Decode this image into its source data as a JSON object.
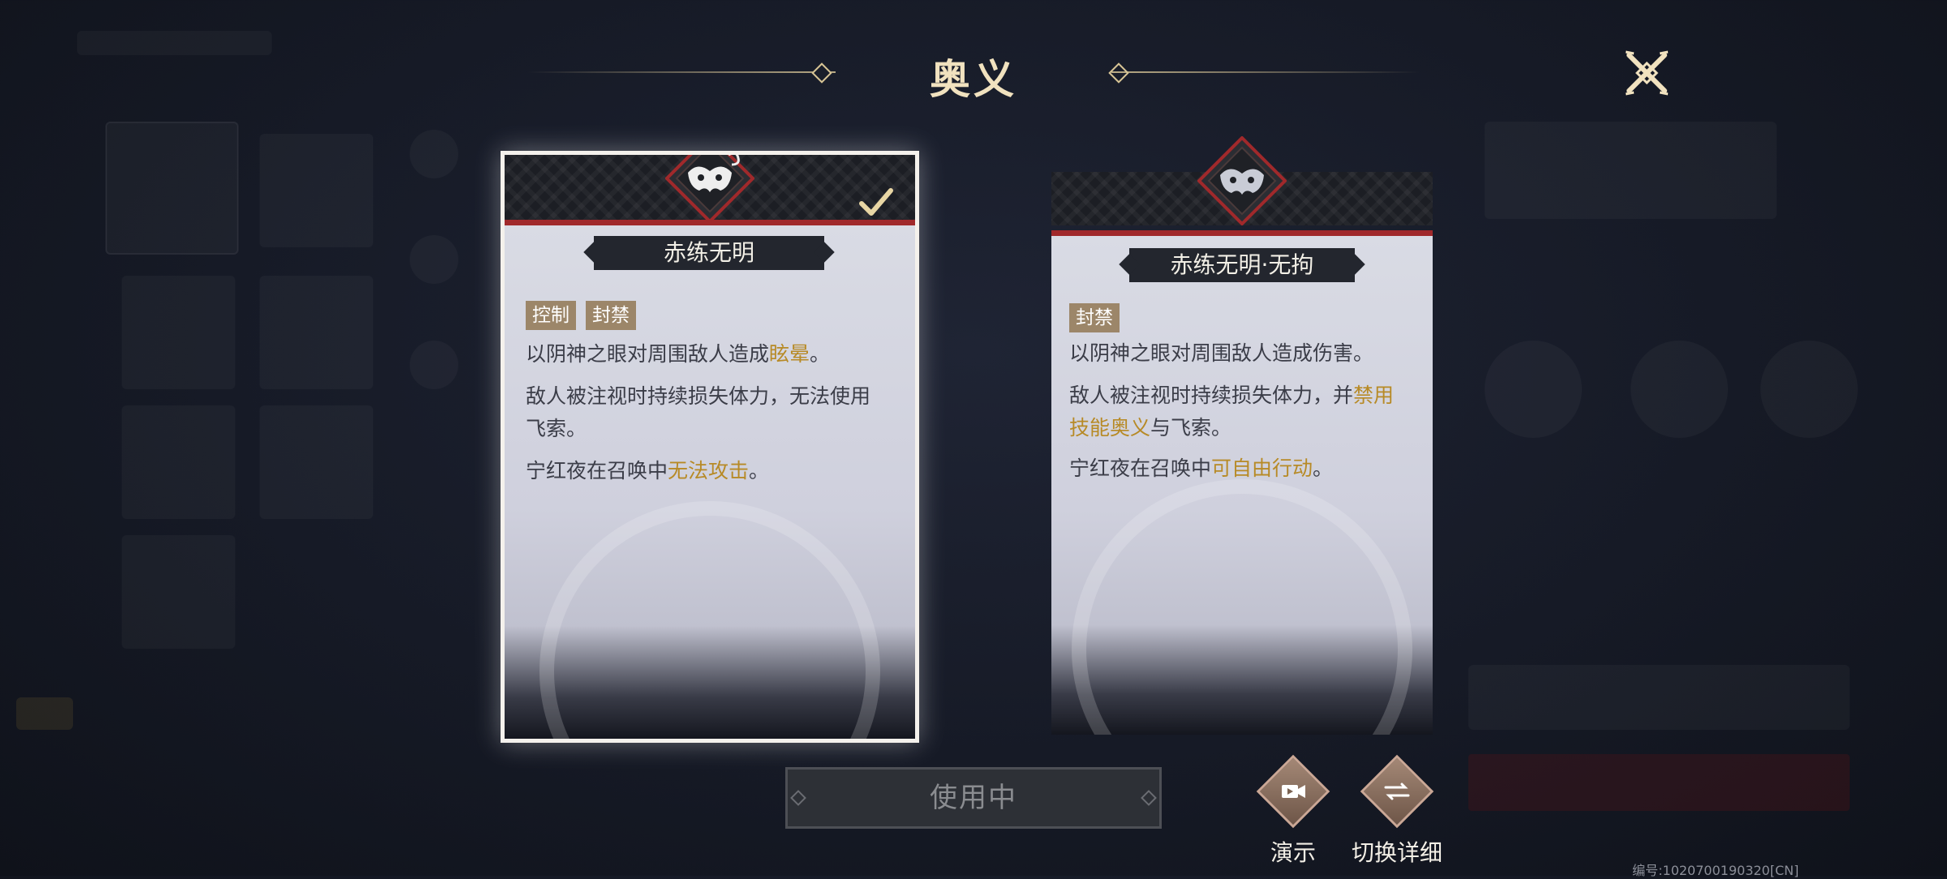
{
  "header": {
    "title": "奥义"
  },
  "cards": [
    {
      "name": "赤练无明",
      "selected": true,
      "tags": [
        "控制",
        "封禁"
      ],
      "lines": [
        {
          "pre": "以阴神之眼对周围敌人造成",
          "hl": "眩晕",
          "post": "。"
        },
        {
          "pre": "敌人被注视时持续损失体力，无法使用飞索。",
          "hl": "",
          "post": ""
        },
        {
          "pre": "宁红夜在召唤中",
          "hl": "无法攻击",
          "post": "。"
        }
      ]
    },
    {
      "name": "赤练无明·无拘",
      "selected": false,
      "tags": [
        "封禁"
      ],
      "lines": [
        {
          "pre": "以阴神之眼对周围敌人造成伤害。",
          "hl": "",
          "post": ""
        },
        {
          "pre": "敌人被注视时持续损失体力，并",
          "hl": "禁用技能奥义",
          "post": "与飞索。"
        },
        {
          "pre": "宁红夜在召唤中",
          "hl": "可自由行动",
          "post": "。"
        }
      ]
    }
  ],
  "actions": {
    "use_label": "使用中",
    "demo_label": "演示",
    "switch_label": "切换详细"
  },
  "footer": {
    "code": "编号:1020700190320[CN]"
  },
  "colors": {
    "highlight": "#b78a26",
    "tag_bg": "#9c8669",
    "accent_red": "#a0292b",
    "title_gold": "#f1e2bf"
  },
  "icons": {
    "close": "close-x-icon",
    "emblem": "mask-emblem-icon",
    "check": "checkmark-icon",
    "demo": "video-camera-icon",
    "switch": "switch-lines-icon"
  }
}
